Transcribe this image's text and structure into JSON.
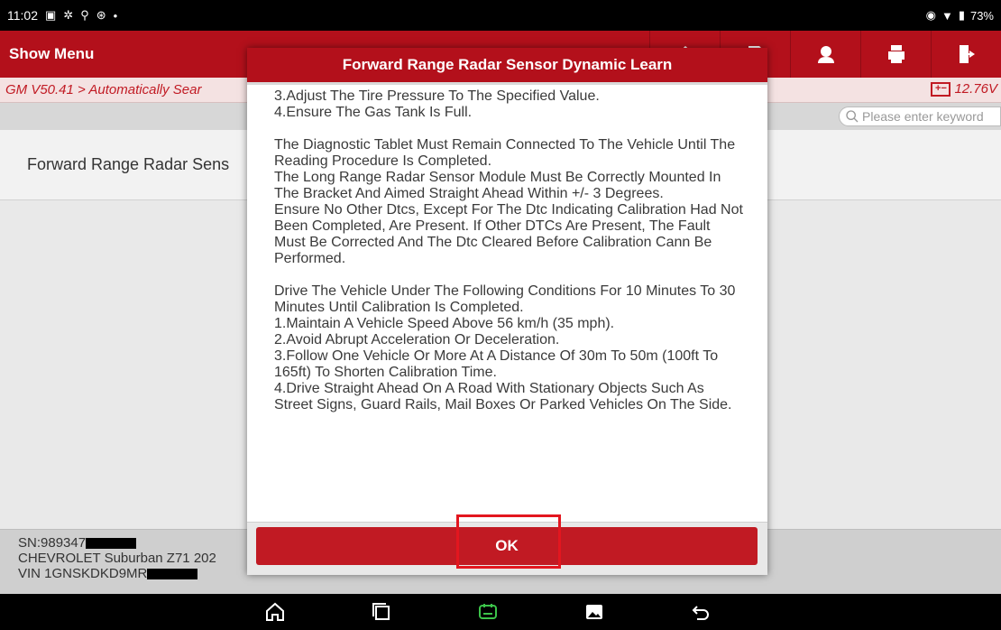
{
  "status_bar": {
    "time": "11:02",
    "battery_pct": "73%"
  },
  "app_bar": {
    "menu_label": "Show Menu"
  },
  "breadcrumb": {
    "path": "GM V50.41 > Automatically Sear",
    "voltage": "12.76V"
  },
  "search": {
    "placeholder": "Please enter keyword"
  },
  "content": {
    "list_item": "Forward Range Radar Sens"
  },
  "footer": {
    "sn": "SN:989347",
    "vehicle": "CHEVROLET Suburban Z71 202",
    "vin": "VIN 1GNSKDKD9MR"
  },
  "dialog": {
    "title": "Forward Range Radar Sensor Dynamic Learn",
    "body": "3.Adjust The Tire Pressure To The Specified Value.\n4.Ensure The Gas Tank Is Full.\n\nThe Diagnostic Tablet Must Remain Connected To The Vehicle Until The Reading Procedure Is Completed.\nThe Long Range Radar Sensor Module Must Be Correctly Mounted In The Bracket And Aimed Straight Ahead Within +/- 3 Degrees.\nEnsure No Other Dtcs, Except For The Dtc Indicating Calibration Had Not Been Completed, Are Present. If Other DTCs Are Present, The Fault Must Be Corrected And The Dtc Cleared Before Calibration Cann Be Performed.\n\nDrive The Vehicle Under The Following Conditions For 10 Minutes To 30 Minutes Until Calibration Is Completed.\n1.Maintain A Vehicle Speed Above 56 km/h (35 mph).\n2.Avoid Abrupt Acceleration Or Deceleration.\n3.Follow One Vehicle Or More At A Distance Of 30m To 50m (100ft To 165ft) To Shorten Calibration Time.\n4.Drive Straight Ahead On A Road With Stationary Objects Such As Street Signs, Guard Rails, Mail Boxes Or Parked Vehicles On The Side.",
    "ok_label": "OK"
  },
  "colors": {
    "brand_red": "#b3101b",
    "highlight": "#e3161f"
  }
}
